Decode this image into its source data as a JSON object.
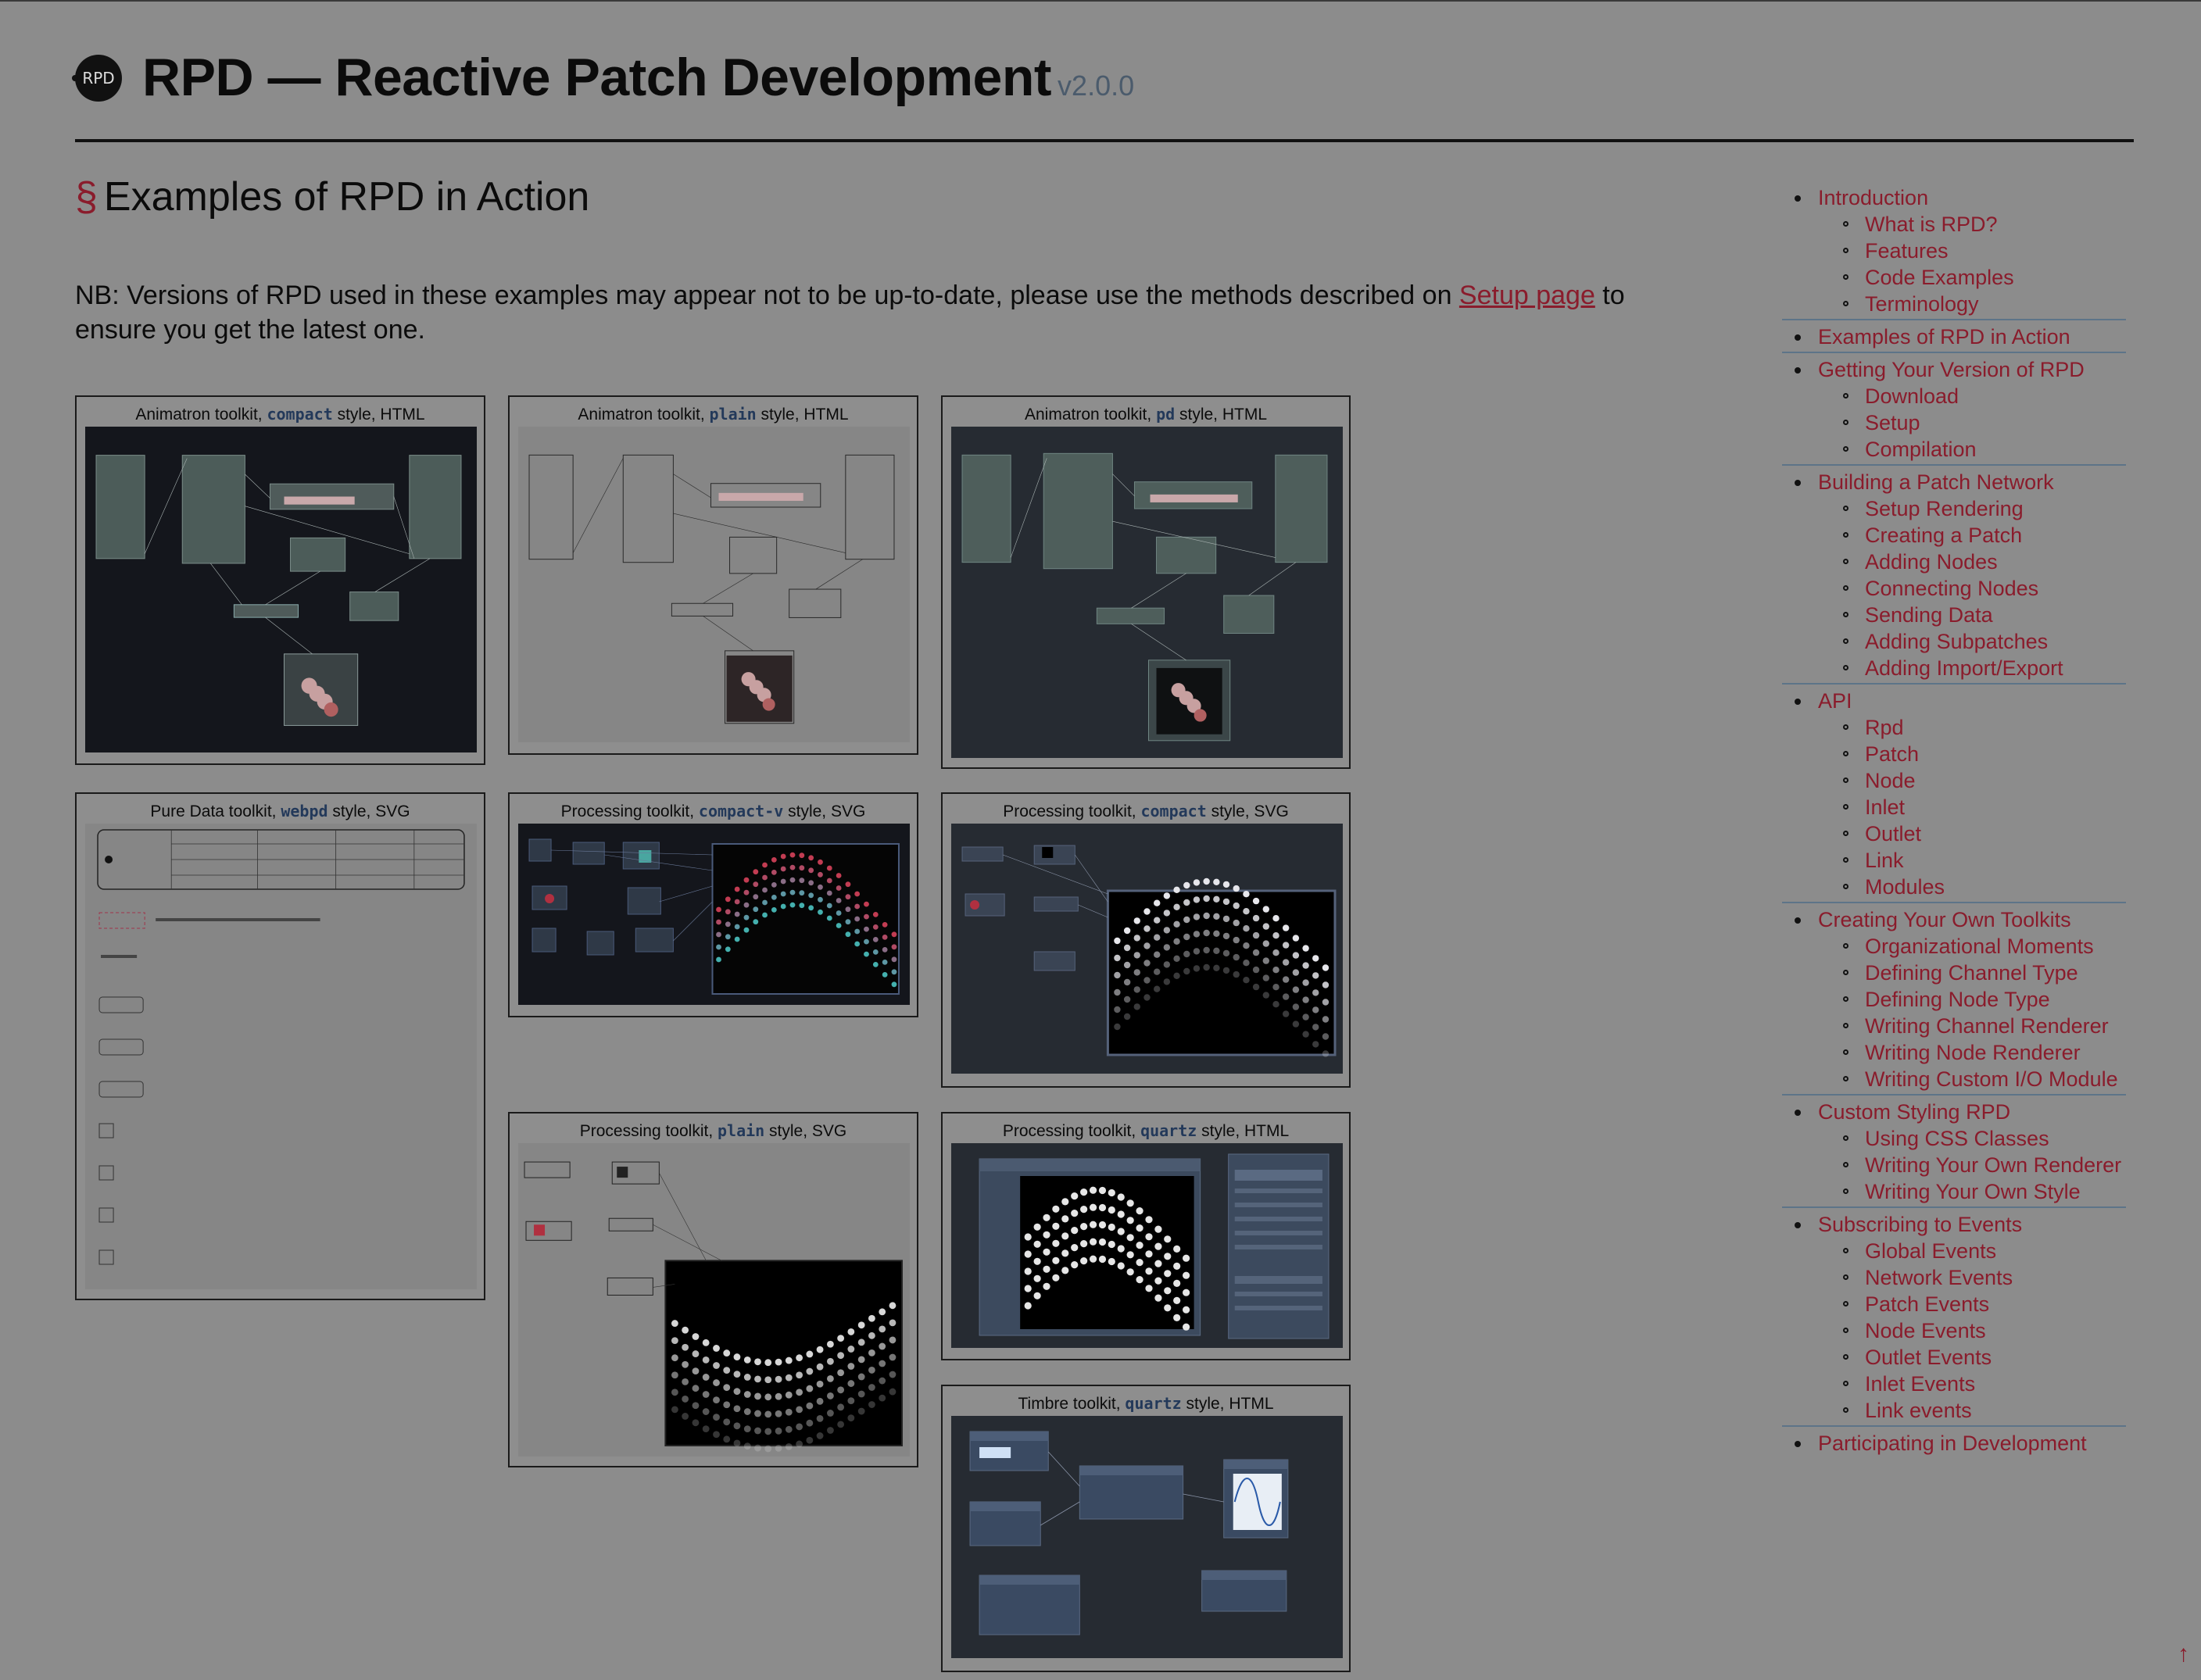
{
  "header": {
    "logo_text": "RPD",
    "title": "RPD — Reactive Patch Development",
    "version": "v2.0.0"
  },
  "section": {
    "mark": "§",
    "title": "Examples of RPD in Action"
  },
  "note": {
    "before": "NB: Versions of RPD used in these examples may appear not to be up-to-date, please use the methods described on ",
    "link": "Setup page",
    "after": " to ensure you get the latest one."
  },
  "examples": [
    {
      "pre": "Animatron toolkit, ",
      "code": "compact",
      "post": " style, HTML"
    },
    {
      "pre": "Animatron toolkit, ",
      "code": "plain",
      "post": " style, HTML"
    },
    {
      "pre": "Animatron toolkit, ",
      "code": "pd",
      "post": " style, HTML"
    },
    {
      "pre": "Pure Data toolkit, ",
      "code": "webpd",
      "post": " style, SVG"
    },
    {
      "pre": "Processing toolkit, ",
      "code": "compact-v",
      "post": " style, SVG"
    },
    {
      "pre": "Processing toolkit, ",
      "code": "compact",
      "post": " style, SVG"
    },
    {
      "pre": "Processing toolkit, ",
      "code": "plain",
      "post": " style, SVG"
    },
    {
      "pre": "Processing toolkit, ",
      "code": "quartz",
      "post": " style, HTML"
    },
    {
      "pre": "Timbre toolkit, ",
      "code": "quartz",
      "post": " style, HTML"
    }
  ],
  "toc": [
    {
      "label": "Introduction",
      "items": [
        "What is RPD?",
        "Features",
        "Code Examples",
        "Terminology"
      ]
    },
    {
      "label": "Examples of RPD in Action",
      "items": []
    },
    {
      "label": "Getting Your Version of RPD",
      "items": [
        "Download",
        "Setup",
        "Compilation"
      ]
    },
    {
      "label": "Building a Patch Network",
      "items": [
        "Setup Rendering",
        "Creating a Patch",
        "Adding Nodes",
        "Connecting Nodes",
        "Sending Data",
        "Adding Subpatches",
        "Adding Import/Export"
      ]
    },
    {
      "label": "API",
      "items": [
        "Rpd",
        "Patch",
        "Node",
        "Inlet",
        "Outlet",
        "Link",
        "Modules"
      ]
    },
    {
      "label": "Creating Your Own Toolkits",
      "items": [
        "Organizational Moments",
        "Defining Channel Type",
        "Defining Node Type",
        "Writing Channel Renderer",
        "Writing Node Renderer",
        "Writing Custom I/O Module"
      ]
    },
    {
      "label": "Custom Styling RPD",
      "items": [
        "Using CSS Classes",
        "Writing Your Own Renderer",
        "Writing Your Own Style"
      ]
    },
    {
      "label": "Subscribing to Events",
      "items": [
        "Global Events",
        "Network Events",
        "Patch Events",
        "Node Events",
        "Outlet Events",
        "Inlet Events",
        "Link events"
      ]
    },
    {
      "label": "Participating in Development",
      "items": []
    }
  ],
  "back_to_top": "↑",
  "colors": {
    "link": "#8a1c2c",
    "code": "#23395a",
    "rule": "#5d7488",
    "background": "#8c8c8c"
  }
}
